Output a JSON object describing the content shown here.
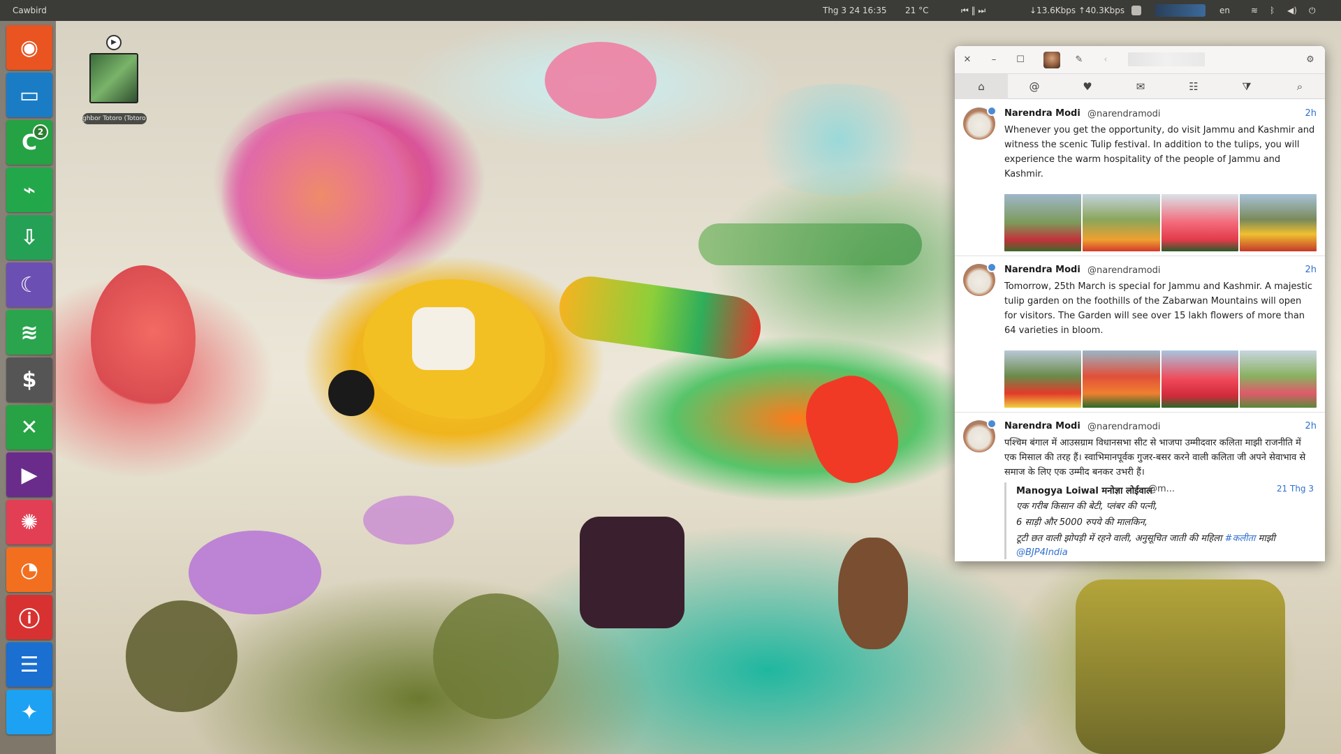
{
  "top_panel": {
    "app_title": "Cawbird",
    "datetime": "Thg 3 24  16:35",
    "weather": "21 °C",
    "media_controls": "⏮ ‖ ⏭",
    "network": "↓13.6Kbps ↑40.3Kbps",
    "language": "en"
  },
  "launcher": {
    "items": [
      {
        "name": "ubuntu",
        "glyph": "◉",
        "color": "#e95420"
      },
      {
        "name": "files",
        "glyph": "▭",
        "color": "#1b7cc6"
      },
      {
        "name": "chat",
        "glyph": "C",
        "color": "#25a244",
        "badge": "2"
      },
      {
        "name": "system-monitor",
        "glyph": "⌁",
        "color": "#22a84a"
      },
      {
        "name": "downloads",
        "glyph": "⇩",
        "color": "#24a155"
      },
      {
        "name": "browser",
        "glyph": "☾",
        "color": "#6b4fb3"
      },
      {
        "name": "wifi",
        "glyph": "≋",
        "color": "#2aa54e"
      },
      {
        "name": "money",
        "glyph": "$",
        "color": "#555555"
      },
      {
        "name": "shuffle",
        "glyph": "✕",
        "color": "#27a244"
      },
      {
        "name": "video-player",
        "glyph": "▶",
        "color": "#6a2c8a"
      },
      {
        "name": "aperture",
        "glyph": "✺",
        "color": "#e23f55"
      },
      {
        "name": "rss",
        "glyph": "◔",
        "color": "#f26f1f"
      },
      {
        "name": "podcast",
        "glyph": "ⓘ",
        "color": "#d73231"
      },
      {
        "name": "news",
        "glyph": "☰",
        "color": "#1a6fd1"
      },
      {
        "name": "twitter",
        "glyph": "✦",
        "color": "#1da1f2"
      }
    ]
  },
  "desktop_icon": {
    "label": "ghbor Totoro (Totoro)"
  },
  "window": {
    "tabs": [
      {
        "name": "home",
        "glyph": "⌂"
      },
      {
        "name": "mentions",
        "glyph": "@"
      },
      {
        "name": "favorites",
        "glyph": "♥"
      },
      {
        "name": "messages",
        "glyph": "✉"
      },
      {
        "name": "lists",
        "glyph": "☷"
      },
      {
        "name": "filters",
        "glyph": "⧩"
      },
      {
        "name": "search",
        "glyph": "⌕"
      }
    ],
    "tweets": [
      {
        "name": "Narendra Modi",
        "handle": "@narendramodi",
        "time": "2h",
        "text": "Whenever you get the opportunity, do visit Jammu and Kashmir and witness the scenic Tulip festival. In addition to the tulips, you will experience the warm hospitality of the people of Jammu and Kashmir."
      },
      {
        "name": "Narendra Modi",
        "handle": "@narendramodi",
        "time": "2h",
        "text": "Tomorrow, 25th March is special for Jammu and Kashmir. A majestic tulip garden on the foothills of the Zabarwan Mountains will open for visitors. The Garden will see over 15 lakh flowers of more than 64 varieties in bloom."
      },
      {
        "name": "Narendra Modi",
        "handle": "@narendramodi",
        "time": "2h",
        "text": "पश्चिम बंगाल में आउसग्राम विधानसभा सीट से भाजपा उम्मीदवार कलिता माझी राजनीति में एक मिसाल की तरह हैं। स्वाभिमानपूर्वक गुजर-बसर करने वाली कलिता जी अपने सेवाभाव से समाज के लिए एक उम्मीद बनकर उभरी हैं।",
        "quote": {
          "name": "Manogya Loiwal मनोज्ञा लोईवाल",
          "handle": "@m...",
          "time": "21 Thg 3",
          "line1": "एक गरीब किसान की बेटी, प्लंबर की पत्नी,",
          "line2": "6 साड़ी और 5000 रुपये की मालकिन,",
          "line3": "टूटी छत वाली झोपड़ी में रहने वाली, अनुसूचित जाती की महिला ",
          "line3_tag": "#कलीता",
          "line3_end": " माझी",
          "line4": "@BJP4India"
        }
      }
    ]
  }
}
